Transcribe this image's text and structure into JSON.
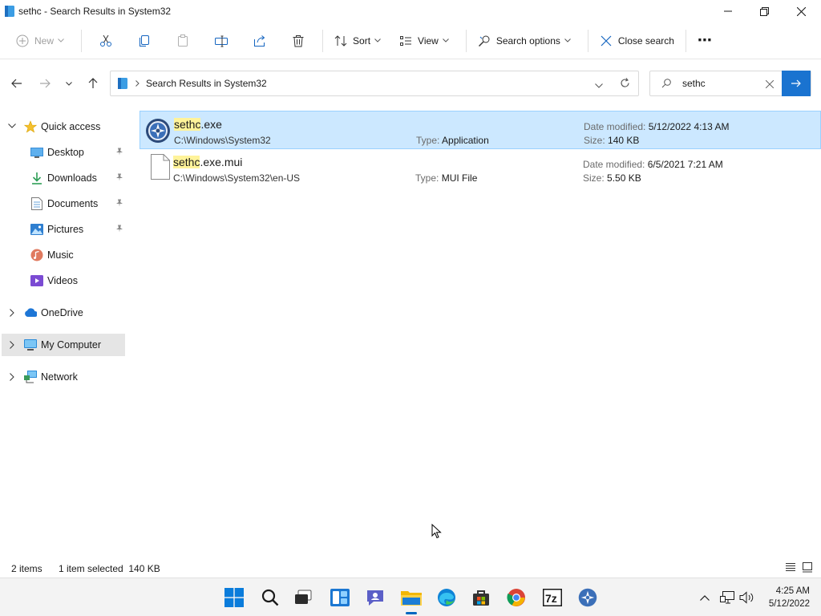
{
  "window": {
    "title": "sethc - Search Results in System32"
  },
  "toolbar": {
    "new_label": "New",
    "sort_label": "Sort",
    "view_label": "View",
    "search_options_label": "Search options",
    "close_search_label": "Close search",
    "more_label": "⋯"
  },
  "address": {
    "crumb": "Search Results in System32",
    "separator": ">"
  },
  "search": {
    "value": "sethc"
  },
  "sidebar": {
    "items": [
      {
        "label": "Quick access"
      },
      {
        "label": "Desktop"
      },
      {
        "label": "Downloads"
      },
      {
        "label": "Documents"
      },
      {
        "label": "Pictures"
      },
      {
        "label": "Music"
      },
      {
        "label": "Videos"
      },
      {
        "label": "OneDrive"
      },
      {
        "label": "My Computer"
      },
      {
        "label": "Network"
      }
    ]
  },
  "files": [
    {
      "name_match": "sethc",
      "name_rest": ".exe",
      "path": "C:\\Windows\\System32",
      "type_label": "Type:",
      "type": "Application",
      "date_label": "Date modified:",
      "date": "5/12/2022 4:13 AM",
      "size_label": "Size:",
      "size": "140 KB",
      "selected": true
    },
    {
      "name_match": "sethc",
      "name_rest": ".exe.mui",
      "path": "C:\\Windows\\System32\\en-US",
      "type_label": "Type:",
      "type": "MUI File",
      "date_label": "Date modified:",
      "date": "6/5/2021 7:21 AM",
      "size_label": "Size:",
      "size": "5.50 KB",
      "selected": false
    }
  ],
  "status": {
    "count": "2 items",
    "selection": "1 item selected  140 KB"
  },
  "clock": {
    "time": "4:25 AM",
    "date": "5/12/2022"
  },
  "colors": {
    "accent": "#0067c0",
    "selection_bg": "#cce8ff",
    "highlight": "#fff39a"
  }
}
